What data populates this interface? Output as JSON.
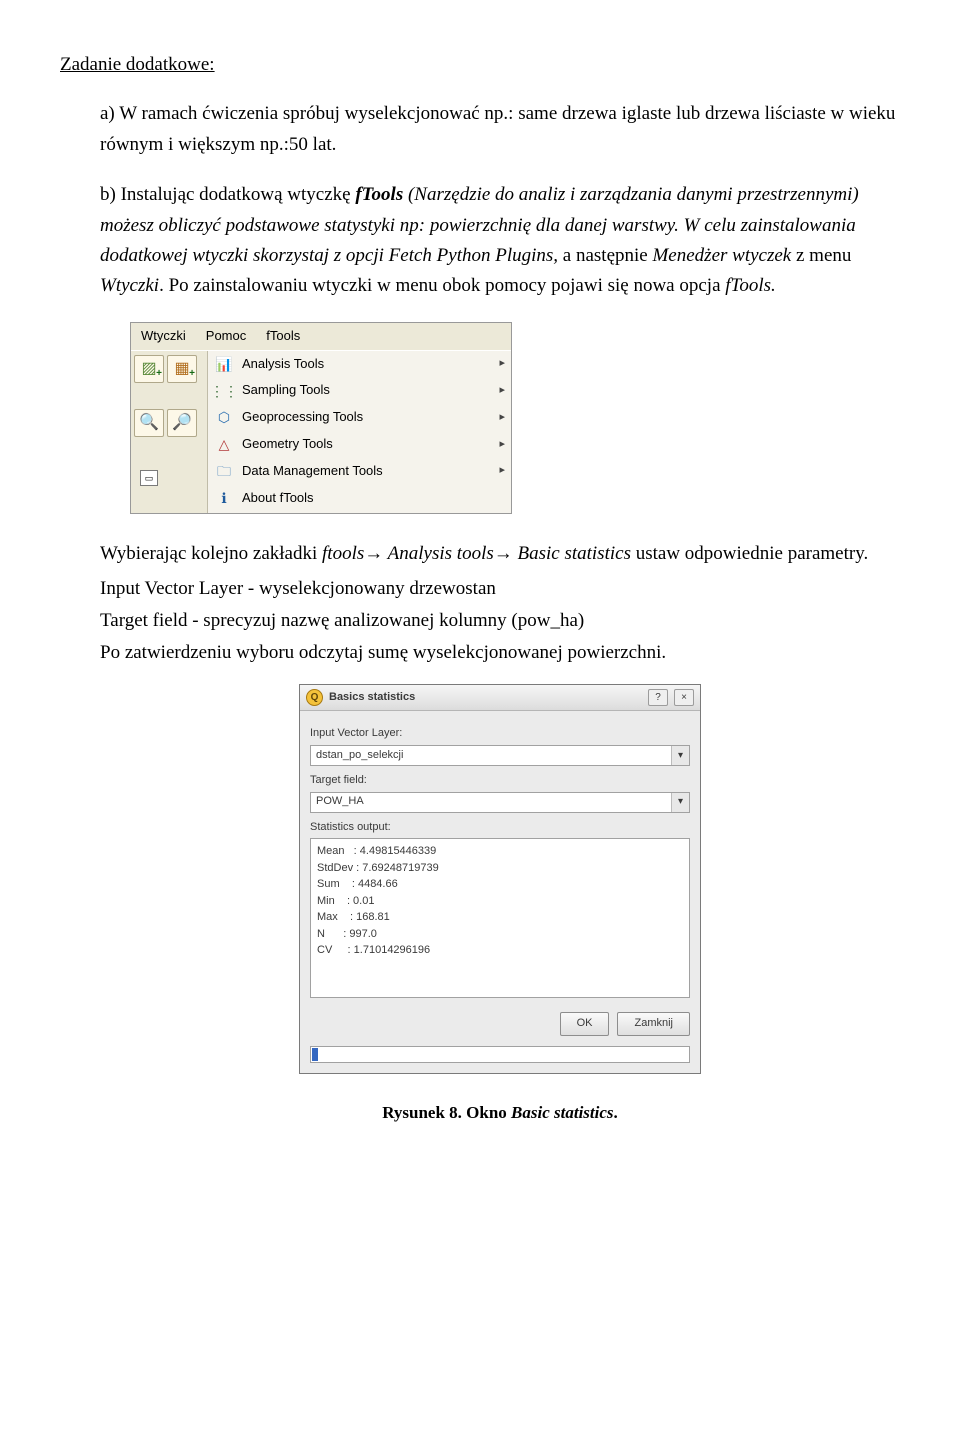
{
  "heading": "Zadanie dodatkowe:",
  "items": {
    "a": {
      "label": "a)",
      "text": "W ramach ćwiczenia spróbuj wyselekcjonować np.: same drzewa iglaste lub drzewa liściaste w wieku równym i większym np.:50 lat."
    },
    "b": {
      "label": "b)",
      "part1_before": "Instalując dodatkową wtyczkę ",
      "part1_tool": "fTools",
      "part1_after": " (Narzędzie do analiz i zarządzania danymi przestrzennymi) możesz obliczyć podstawowe statystyki np: powierzchnię dla danej warstwy. W celu zainstalowania dodatkowej wtyczki skorzystaj z opcji ",
      "part2_tool1": "Fetch Python Plugins,",
      "part2_mid": " a następnie ",
      "part2_tool2": "Menedżer wtyczek",
      "part2_mid2": " z menu ",
      "part2_tool3": "Wtyczki",
      "part2_after": ". Po zainstalowaniu wtyczki w menu obok pomocy pojawi się nowa opcja ",
      "part2_tool4": "fTools.",
      "para2_before": "Wybierając kolejno zakładki ",
      "para2_italic": "ftools→ Analysis tools→ Basic statistics",
      "para2_after": " ustaw odpowiednie parametry.",
      "line_input": "Input Vector Layer -  wyselekcjonowany drzewostan",
      "line_target": "Target field - sprecyzuj nazwę analizowanej kolumny (pow_ha)",
      "line_sum": "Po zatwierdzeniu wyboru odczytaj sumę wyselekcjonowanej powierzchni."
    }
  },
  "menu": {
    "bar": [
      "Wtyczki",
      "Pomoc",
      "fTools"
    ],
    "items": [
      {
        "label": "Analysis Tools",
        "icon": "analysis-icon"
      },
      {
        "label": "Sampling Tools",
        "icon": "sampling-icon"
      },
      {
        "label": "Geoprocessing Tools",
        "icon": "geoprocessing-icon"
      },
      {
        "label": "Geometry Tools",
        "icon": "geometry-icon"
      },
      {
        "label": "Data Management Tools",
        "icon": "data-mgmt-icon"
      },
      {
        "label": "About fTools",
        "icon": "about-icon"
      }
    ]
  },
  "dialog": {
    "title": "Basics statistics",
    "labels": {
      "input": "Input Vector Layer:",
      "target": "Target field:",
      "output": "Statistics output:"
    },
    "input_value": "dstan_po_selekcji",
    "target_value": "POW_HA",
    "stats": "Mean   : 4.49815446339\nStdDev : 7.69248719739\nSum    : 4484.66\nMin    : 0.01\nMax    : 168.81\nN      : 997.0\nCV     : 1.71014296196",
    "buttons": {
      "ok": "OK",
      "close": "Zamknij"
    }
  },
  "caption": {
    "prefix": "Rysunek 8. Okno ",
    "italic": "Basic statistics",
    "suffix": "."
  }
}
